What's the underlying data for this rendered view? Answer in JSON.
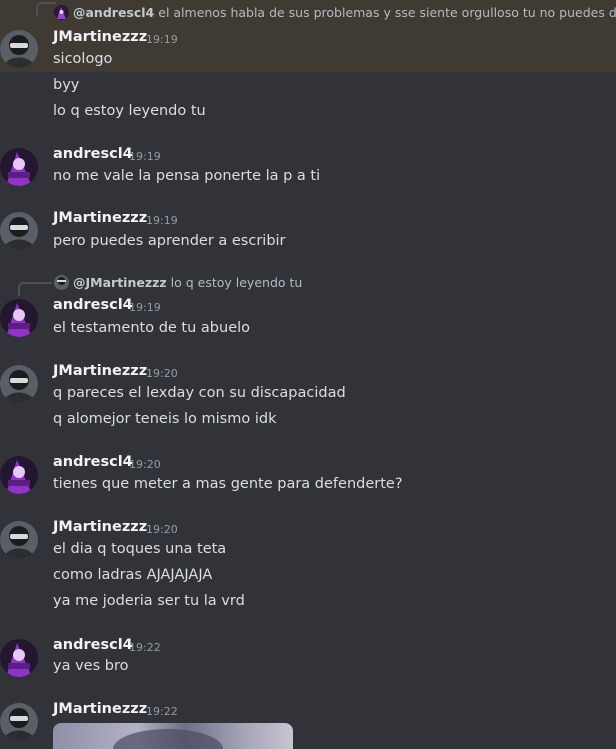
{
  "channel": {
    "messages": [
      {
        "reply": {
          "user": "@andrescl4",
          "text": "el almenos habla de sus problemas y sse siente orgulloso tu no puedes decir na"
        },
        "author": "JMartinezzz",
        "time": "19:19",
        "lines": [
          "sicologo",
          "byy",
          "lo q estoy leyendo tu"
        ],
        "highlighted": true
      },
      {
        "author": "andrescl4",
        "time": "19:19",
        "lines": [
          "no me vale la pensa ponerte la p a ti"
        ]
      },
      {
        "author": "JMartinezzz",
        "time": "19:19",
        "lines": [
          "pero puedes aprender a escribir"
        ]
      },
      {
        "reply": {
          "user": "@JMartinezzz",
          "text": "lo q estoy leyendo tu"
        },
        "author": "andrescl4",
        "time": "19:19",
        "lines": [
          "el testamento de tu abuelo"
        ]
      },
      {
        "author": "JMartinezzz",
        "time": "19:20",
        "lines": [
          "q pareces el lexday con su discapacidad",
          "q alomejor teneis lo mismo idk"
        ]
      },
      {
        "author": "andrescl4",
        "time": "19:20",
        "lines": [
          "tienes que meter a mas gente para defenderte?"
        ]
      },
      {
        "author": "JMartinezzz",
        "time": "19:20",
        "lines": [
          "el dia q toques una teta",
          "como ladras AJAJAJAJA",
          "ya me joderia ser tu la vrd"
        ]
      },
      {
        "author": "andrescl4",
        "time": "19:22",
        "lines": [
          "ya ves bro"
        ]
      },
      {
        "author": "JMartinezzz",
        "time": "19:22",
        "lines": [],
        "attachment": "image"
      }
    ]
  },
  "colors": {
    "background": "#313338",
    "highlight": "#3f3b33",
    "username": "#f2f3f5",
    "text": "#dbdee1",
    "timestamp": "#949ba4"
  },
  "icons": {
    "jmartinezzz_avatar": "dark-character-avatar-icon",
    "andrescl4_avatar": "purple-character-avatar-icon"
  }
}
